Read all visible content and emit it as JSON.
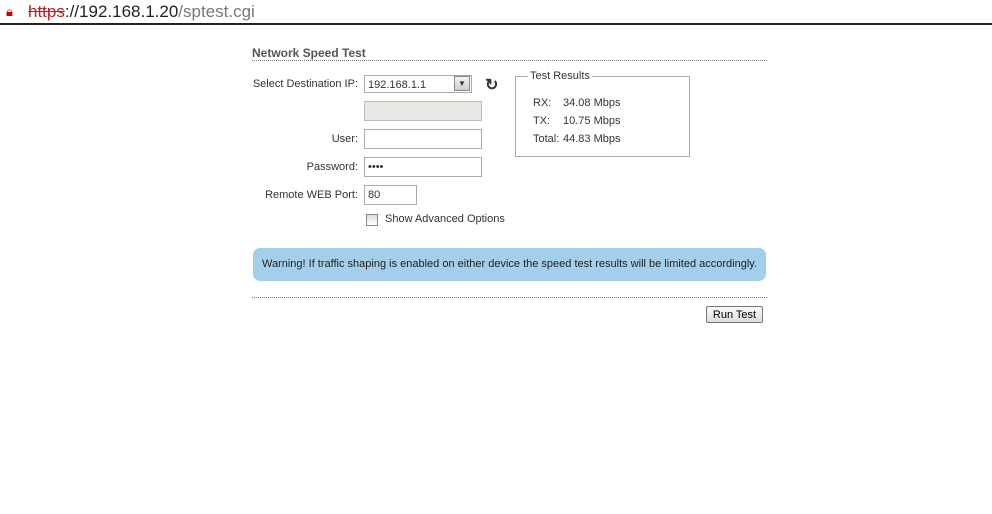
{
  "browser": {
    "url_scheme": "https",
    "url_host": "://192.168.1.20",
    "url_path": "/sptest.cgi"
  },
  "page": {
    "title": "Network Speed Test"
  },
  "form": {
    "dest_ip_label": "Select Destination IP:",
    "dest_ip_value": "192.168.1.1",
    "user_label": "User:",
    "user_value": "",
    "password_label": "Password:",
    "password_value": "••••",
    "port_label": "Remote WEB Port:",
    "port_value": "80",
    "advanced_label": "Show Advanced Options"
  },
  "results": {
    "legend": "Test Results",
    "rx_label": "RX:",
    "rx_value": "34.08 Mbps",
    "tx_label": "TX:",
    "tx_value": "10.75 Mbps",
    "total_label": "Total:",
    "total_value": "44.83 Mbps"
  },
  "warning": "Warning! If traffic shaping is enabled on either device the speed test results will be limited accordingly.",
  "run_button": "Run Test"
}
